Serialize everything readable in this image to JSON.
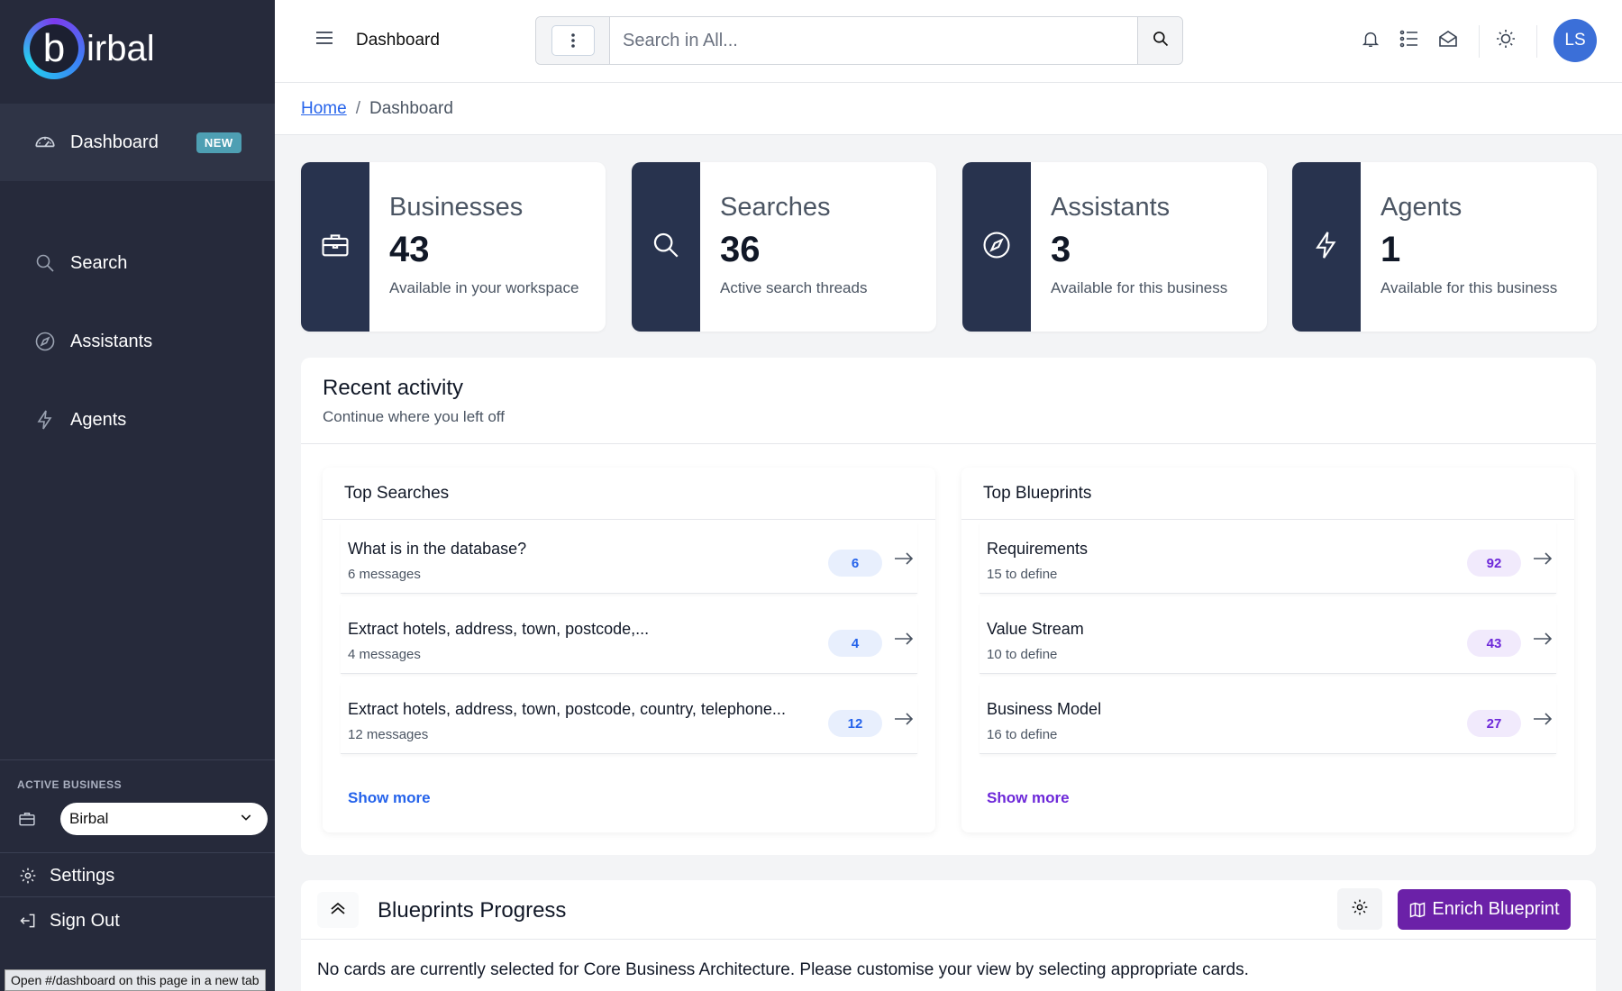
{
  "app": {
    "logo_letter": "b",
    "logo_text": "irbal"
  },
  "sidebar": {
    "items": [
      {
        "label": "Dashboard",
        "icon": "speedometer-icon",
        "badge": "NEW"
      },
      {
        "label": "Search",
        "icon": "search-icon"
      },
      {
        "label": "Assistants",
        "icon": "compass-icon"
      },
      {
        "label": "Agents",
        "icon": "lightning-icon"
      }
    ],
    "active_business_label": "ACTIVE BUSINESS",
    "active_business_value": "Birbal",
    "settings_label": "Settings",
    "signout_label": "Sign Out",
    "status_tooltip": "Open #/dashboard on this page in a new tab"
  },
  "header": {
    "title": "Dashboard",
    "search_placeholder": "Search in All...",
    "avatar_initials": "LS"
  },
  "breadcrumb": {
    "home": "Home",
    "separator": "/",
    "current": "Dashboard"
  },
  "stats": [
    {
      "title": "Businesses",
      "value": "43",
      "subtitle": "Available in your workspace",
      "icon": "briefcase-icon"
    },
    {
      "title": "Searches",
      "value": "36",
      "subtitle": "Active search threads",
      "icon": "search-icon"
    },
    {
      "title": "Assistants",
      "value": "3",
      "subtitle": "Available for this business",
      "icon": "compass-icon"
    },
    {
      "title": "Agents",
      "value": "1",
      "subtitle": "Available for this business",
      "icon": "lightning-icon"
    }
  ],
  "recent": {
    "title": "Recent activity",
    "subtitle": "Continue where you left off",
    "top_searches": {
      "title": "Top Searches",
      "rows": [
        {
          "title": "What is in the database?",
          "subtitle": "6 messages",
          "count": "6"
        },
        {
          "title": "Extract hotels, address, town, postcode,...",
          "subtitle": "4 messages",
          "count": "4"
        },
        {
          "title": "Extract hotels, address, town, postcode, country, telephone...",
          "subtitle": "12 messages",
          "count": "12"
        }
      ],
      "show_more": "Show more"
    },
    "top_blueprints": {
      "title": "Top Blueprints",
      "rows": [
        {
          "title": "Requirements",
          "subtitle": "15 to define",
          "count": "92"
        },
        {
          "title": "Value Stream",
          "subtitle": "10 to define",
          "count": "43"
        },
        {
          "title": "Business Model",
          "subtitle": "16 to define",
          "count": "27"
        }
      ],
      "show_more": "Show more"
    }
  },
  "blueprints": {
    "title": "Blueprints Progress",
    "enrich_label": "Enrich Blueprint",
    "message": "No cards are currently selected for Core Business Architecture. Please customise your view by selecting appropriate cards."
  },
  "colors": {
    "sidebar_bg": "#262a3b",
    "stat_side": "#28334e",
    "link_blue": "#2563eb",
    "accent_purple": "#6b21a8",
    "badge_teal": "#4e9fb3"
  }
}
